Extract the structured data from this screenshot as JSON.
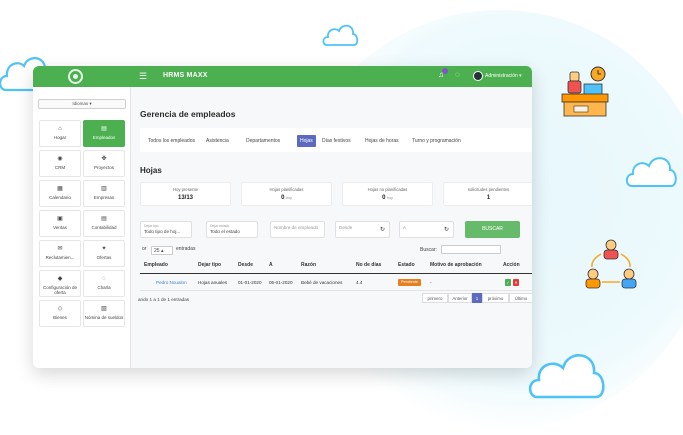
{
  "app": {
    "brand": "HRMS MAXX",
    "user": "Administración"
  },
  "sidebar": {
    "language_label": "Idiomas",
    "tiles": [
      {
        "label": "Hogar",
        "icon": "home-icon",
        "glyph": "⌂",
        "active": false
      },
      {
        "label": "Empleados",
        "icon": "employees-icon",
        "glyph": "▤",
        "active": true
      },
      {
        "label": "CRM",
        "icon": "crm-icon",
        "glyph": "◉",
        "active": false
      },
      {
        "label": "Proyectos",
        "icon": "projects-icon",
        "glyph": "✤",
        "active": false
      },
      {
        "label": "Calendario",
        "icon": "calendar-icon",
        "glyph": "▦",
        "active": false
      },
      {
        "label": "Empresas",
        "icon": "building-icon",
        "glyph": "▥",
        "active": false
      },
      {
        "label": "Ventas",
        "icon": "sales-icon",
        "glyph": "▣",
        "active": false
      },
      {
        "label": "Contabilidad",
        "icon": "accounting-icon",
        "glyph": "▤",
        "active": false
      },
      {
        "label": "Reclutamien...",
        "icon": "recruitment-icon",
        "glyph": "✉",
        "active": false
      },
      {
        "label": "Ofertas",
        "icon": "offers-icon",
        "glyph": "✦",
        "active": false
      },
      {
        "label": "Configuración de oferta",
        "icon": "offer-settings-icon",
        "glyph": "◆",
        "active": false
      },
      {
        "label": "Charla",
        "icon": "chat-icon",
        "glyph": "◌",
        "active": false
      },
      {
        "label": "Bienes",
        "icon": "assets-icon",
        "glyph": "◇",
        "active": false
      },
      {
        "label": "Nómina de sueldos",
        "icon": "payroll-icon",
        "glyph": "▧",
        "active": false
      }
    ]
  },
  "page": {
    "title": "Gerencia de empleados",
    "tabs": [
      {
        "label": "Todos los empleados",
        "active": false
      },
      {
        "label": "Asistencia",
        "active": false
      },
      {
        "label": "Departamentos",
        "active": false
      },
      {
        "label": "Hojas",
        "active": true
      },
      {
        "label": "Días festivos",
        "active": false
      },
      {
        "label": "Hojas de horas",
        "active": false
      },
      {
        "label": "Turno y programación",
        "active": false
      }
    ],
    "section": "Hojas",
    "stats": [
      {
        "label": "Hoy presente",
        "value": "13/13",
        "unit": ""
      },
      {
        "label": "Hojas planificadas",
        "value": "0",
        "unit": "hoy"
      },
      {
        "label": "Hojas no planificadas",
        "value": "0",
        "unit": "hoy"
      },
      {
        "label": "solicitudes pendientes",
        "value": "1",
        "unit": ""
      }
    ]
  },
  "filters": {
    "leave_type": {
      "label": "Dejar tipo",
      "value": "Todo tipo de hoj..."
    },
    "status": {
      "label": "Dejar estado",
      "value": "Todo el estado"
    },
    "employee_name": {
      "placeholder": "Nombre de empleado"
    },
    "from": {
      "placeholder": "Desde"
    },
    "to": {
      "placeholder": "A"
    },
    "search_button": "BUSCAR"
  },
  "table_controls": {
    "show_label": "or",
    "page_size": "25",
    "entries_label": "entradas",
    "search_label": "Buscar:"
  },
  "table": {
    "headers": [
      "Empleado",
      "Dejar tipo",
      "Desde",
      "A",
      "Razón",
      "No de días",
      "Estado",
      "Motivo de aprobación",
      "Acción"
    ],
    "rows": [
      {
        "employee": "Pedro Noualon",
        "leave_type": "Hojas anuales",
        "from": "01-01-2020",
        "to": "06-01-2020",
        "reason": "Bebé de vacaciones",
        "days": "4.4",
        "status": "Pendiente",
        "approval_reason": "-"
      }
    ],
    "info": "ando 1 a 1 de 1 entradas"
  },
  "pagination": {
    "first": "primero",
    "prev": "Anterior",
    "current": "1",
    "next": "próximo",
    "last": "Último"
  },
  "colors": {
    "topbar": "#4caf50",
    "active_tab": "#5c6bc0",
    "pending": "#e67e22",
    "approve": "#4caf50",
    "reject": "#e53935",
    "cloud_stroke": "#4fc3f7"
  }
}
